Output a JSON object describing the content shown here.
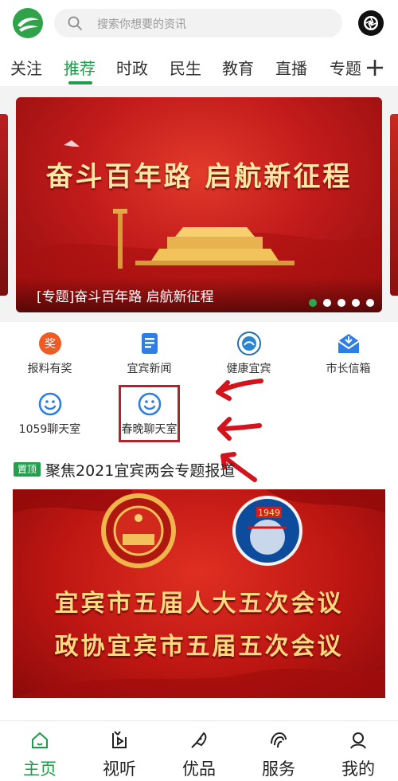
{
  "header": {
    "search_placeholder": "搜索你想要的资讯",
    "icons": {
      "logo": "app-logo",
      "search": "search-icon",
      "camera": "camera-icon"
    }
  },
  "tabs": [
    {
      "label": "关注",
      "active": false
    },
    {
      "label": "推荐",
      "active": true
    },
    {
      "label": "时政",
      "active": false
    },
    {
      "label": "民生",
      "active": false
    },
    {
      "label": "教育",
      "active": false
    },
    {
      "label": "直播",
      "active": false
    },
    {
      "label": "专题",
      "active": false
    }
  ],
  "carousel": {
    "banner_headline": "奋斗百年路 启航新征程",
    "caption": "[专题]奋斗百年路 启航新征程",
    "slide_count": 5,
    "active_slide": 1
  },
  "quick_grid": [
    {
      "label": "报料有奖",
      "icon": "reward-icon"
    },
    {
      "label": "宜宾新闻",
      "icon": "news-document-icon"
    },
    {
      "label": "健康宜宾",
      "icon": "health-emblem-icon"
    },
    {
      "label": "市长信箱",
      "icon": "mailbox-icon"
    },
    {
      "label": "1059聊天室",
      "icon": "chat-face-icon"
    },
    {
      "label": "春晚聊天室",
      "icon": "chat-face-icon"
    }
  ],
  "feature": {
    "pin_badge": "置顶",
    "title": "聚焦2021宜宾两会专题报道",
    "image_line1": "宜宾市五届人大五次会议",
    "image_line2": "政协宜宾市五届五次会议",
    "image_badge_year": "1949"
  },
  "bottom_nav": [
    {
      "label": "主页",
      "icon": "home-icon",
      "active": true
    },
    {
      "label": "视听",
      "icon": "video-icon",
      "active": false
    },
    {
      "label": "优品",
      "icon": "brush-icon",
      "active": false
    },
    {
      "label": "服务",
      "icon": "service-icon",
      "active": false
    },
    {
      "label": "我的",
      "icon": "profile-icon",
      "active": false
    }
  ],
  "colors": {
    "accent": "#1d9c4a",
    "banner_red": "#c21b1b",
    "annotation_red": "#b3232b"
  }
}
